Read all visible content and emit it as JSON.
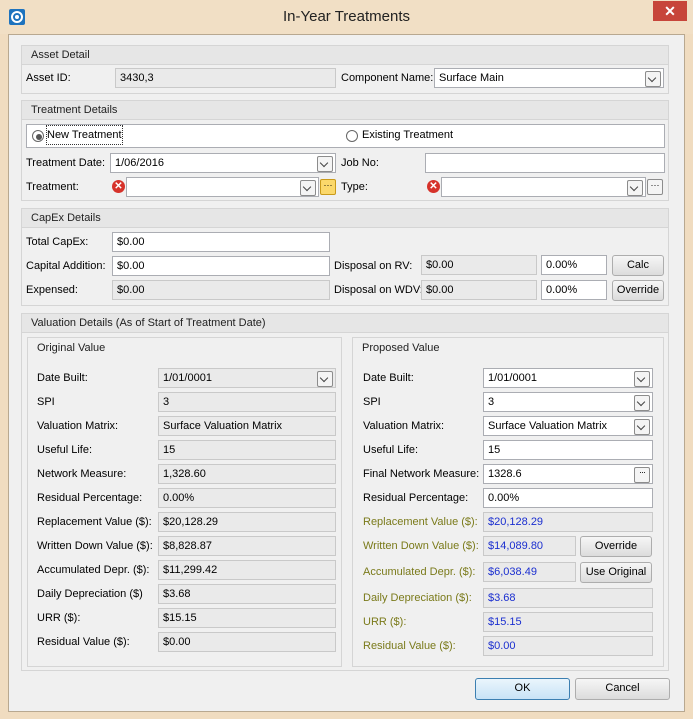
{
  "window": {
    "title": "In-Year Treatments",
    "close_glyph": "✕"
  },
  "asset_detail": {
    "header": "Asset Detail",
    "asset_id_label": "Asset ID:",
    "asset_id_value": "3430,3",
    "component_label": "Component Name:",
    "component_value": "Surface Main"
  },
  "treatment_details": {
    "header": "Treatment Details",
    "new_treatment_label": "New Treatment",
    "existing_treatment_label": "Existing Treatment",
    "selected": "New Treatment",
    "date_label": "Treatment Date:",
    "date_value": "1/06/2016",
    "job_no_label": "Job No:",
    "job_no_value": "",
    "treatment_label": "Treatment:",
    "treatment_value": "",
    "type_label": "Type:",
    "type_value": ""
  },
  "capex": {
    "header": "CapEx Details",
    "total_label": "Total CapEx:",
    "total_value": "$0.00",
    "capital_addition_label": "Capital Addition:",
    "capital_addition_value": "$0.00",
    "expensed_label": "Expensed:",
    "expensed_value": "$0.00",
    "disposal_rv_label": "Disposal on RV:",
    "disposal_rv_value": "$0.00",
    "disposal_rv_pct": "0.00%",
    "disposal_wdv_label": "Disposal on WDV:",
    "disposal_wdv_value": "$0.00",
    "disposal_wdv_pct": "0.00%",
    "calc_label": "Calc",
    "override_label": "Override"
  },
  "valuation": {
    "header": "Valuation Details (As of Start of Treatment Date)",
    "original": {
      "title": "Original Value",
      "date_built_label": "Date Built:",
      "date_built": "1/01/0001",
      "spi_label": "SPI",
      "spi": "3",
      "matrix_label": "Valuation Matrix:",
      "matrix": "Surface Valuation Matrix",
      "useful_life_label": "Useful Life:",
      "useful_life": "15",
      "network_label": "Network Measure:",
      "network": "1,328.60",
      "residual_pct_label": "Residual Percentage:",
      "residual_pct": "0.00%",
      "replacement_label": "Replacement Value ($):",
      "replacement": "$20,128.29",
      "wdv_label": "Written Down Value ($):",
      "wdv": "$8,828.87",
      "accum_label": "Accumulated Depr. ($):",
      "accum": "$11,299.42",
      "daily_label": "Daily Depreciation ($)",
      "daily": "$3.68",
      "urr_label": "URR ($):",
      "urr": "$15.15",
      "residual_value_label": "Residual Value ($):",
      "residual_value": "$0.00"
    },
    "proposed": {
      "title": "Proposed Value",
      "date_built_label": "Date Built:",
      "date_built": "1/01/0001",
      "spi_label": "SPI",
      "spi": "3",
      "matrix_label": "Valuation Matrix:",
      "matrix": "Surface Valuation Matrix",
      "useful_life_label": "Useful Life:",
      "useful_life": "15",
      "network_label": "Final Network Measure:",
      "network": "1328.6",
      "residual_pct_label": "Residual Percentage:",
      "residual_pct": "0.00%",
      "replacement_label": "Replacement Value ($):",
      "replacement": "$20,128.29",
      "wdv_label": "Written Down Value ($):",
      "wdv": "$14,089.80",
      "accum_label": "Accumulated Depr. ($):",
      "accum": "$6,038.49",
      "daily_label": "Daily Depreciation  ($):",
      "daily": "$3.68",
      "urr_label": "URR ($):",
      "urr": "$15.15",
      "residual_value_label": "Residual Value ($):",
      "residual_value": "$0.00",
      "override_label": "Override",
      "use_original_label": "Use Original"
    }
  },
  "footer": {
    "ok_label": "OK",
    "cancel_label": "Cancel"
  },
  "colors": {
    "calculated_label": "#7a7a1a",
    "calculated_value": "#1b2fd0",
    "title_bar": "#f1dfc5",
    "close_button": "#c7453a"
  }
}
